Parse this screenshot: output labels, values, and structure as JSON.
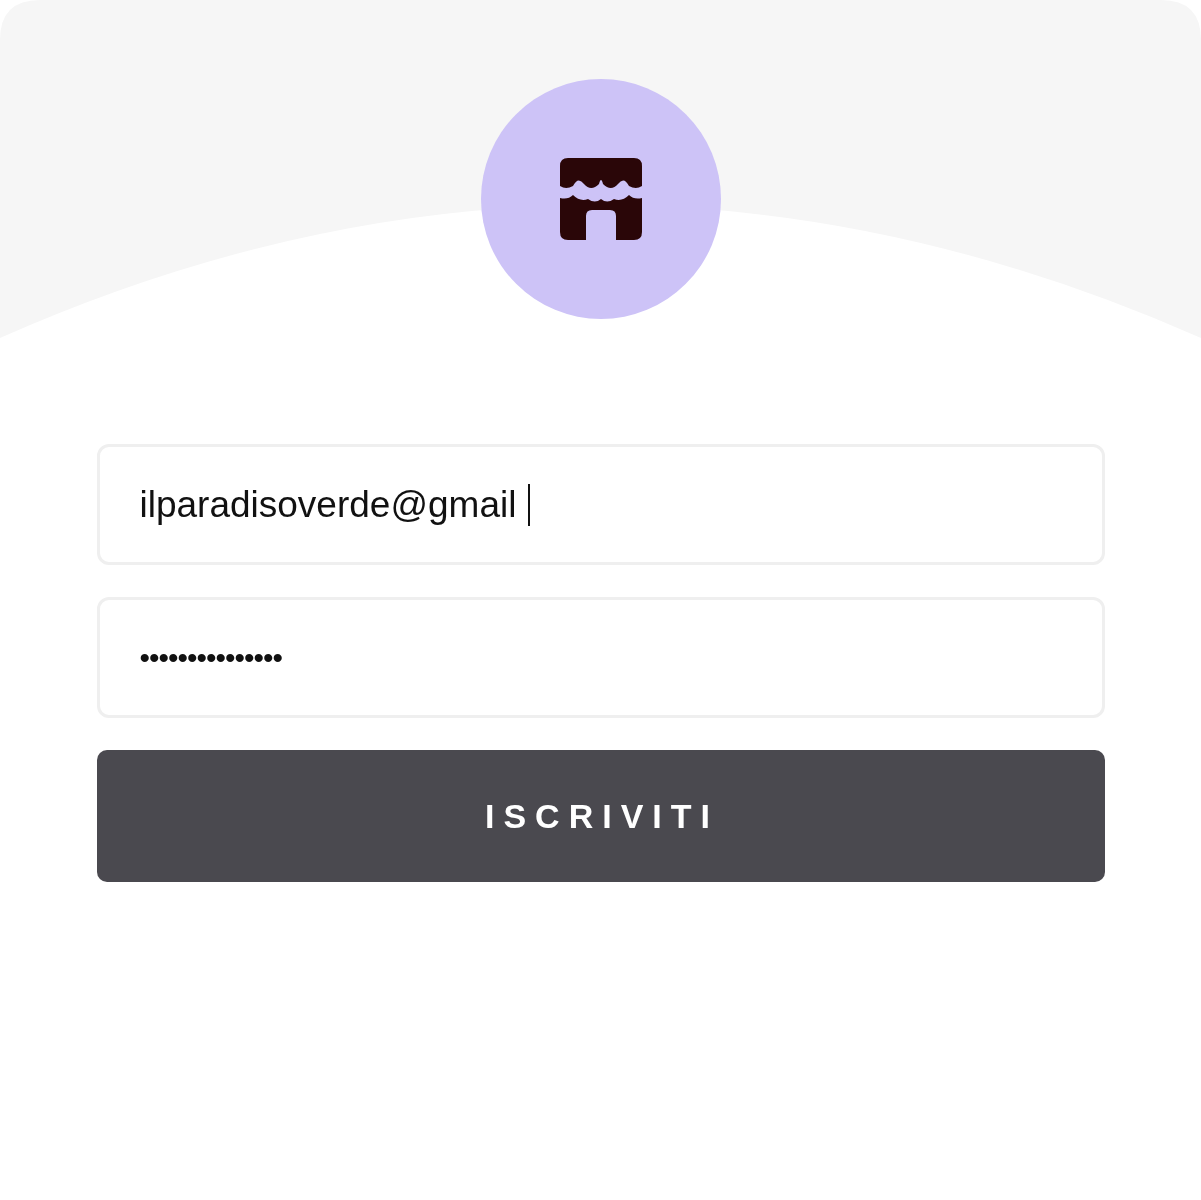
{
  "logo": {
    "kind": "store"
  },
  "form": {
    "fields": [
      {
        "kind": "email",
        "value": "ilparadisoverde@gmail",
        "focused": true
      },
      {
        "kind": "password",
        "value": "•••••••••••••••",
        "focused": false
      }
    ],
    "submit": {
      "label": "ISCRIVITI"
    }
  }
}
